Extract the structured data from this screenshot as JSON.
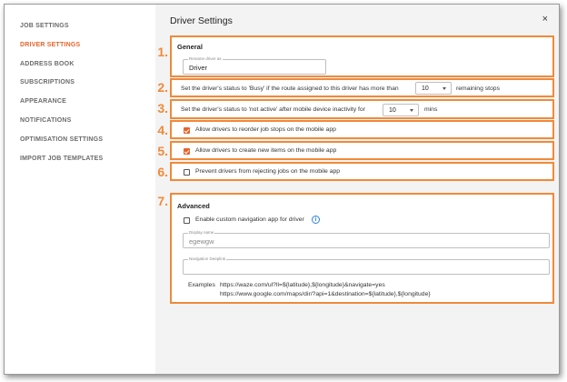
{
  "sidebar": {
    "items": [
      {
        "label": "JOB SETTINGS",
        "active": false
      },
      {
        "label": "DRIVER SETTINGS",
        "active": true
      },
      {
        "label": "ADDRESS BOOK",
        "active": false
      },
      {
        "label": "SUBSCRIPTIONS",
        "active": false
      },
      {
        "label": "APPEARANCE",
        "active": false
      },
      {
        "label": "NOTIFICATIONS",
        "active": false
      },
      {
        "label": "OPTIMISATION SETTINGS",
        "active": false
      },
      {
        "label": "IMPORT JOB TEMPLATES",
        "active": false
      }
    ]
  },
  "header": {
    "title": "Driver Settings",
    "close_label": "×"
  },
  "annotations": [
    "1.",
    "2.",
    "3.",
    "4.",
    "5.",
    "6.",
    "7."
  ],
  "general": {
    "section_title": "General",
    "rename_label": "Rename driver as",
    "rename_value": "Driver"
  },
  "busy": {
    "text_before": "Set the driver's status to 'Busy' if the route assigned to this driver has more than",
    "value": "10",
    "text_after": "remaining stops"
  },
  "inactive": {
    "text_before": "Set the driver's status to 'not active' after mobile device inactivity for",
    "value": "10",
    "text_after": "mins"
  },
  "reorder": {
    "label": "Allow drivers to reorder job stops on the mobile app",
    "checked": true
  },
  "create_items": {
    "label": "Allow drivers to create new items on the mobile app",
    "checked": true
  },
  "prevent_reject": {
    "label": "Prevent drivers from rejecting jobs on the mobile app",
    "checked": false
  },
  "advanced": {
    "section_title": "Advanced",
    "custom_nav_label": "Enable custom navigation app for driver",
    "custom_nav_checked": false,
    "info_icon": "i",
    "display_name_label": "Display name",
    "display_name_value": "egewgw",
    "deeplink_label": "Navigation Deeplink",
    "deeplink_value": "",
    "examples_label": "Examples",
    "example_1": "https://waze.com/ul?ll=${latitude},${longitude}&navigate=yes",
    "example_2": "https://www.google.com/maps/dir/?api=1&destination=${latitude},${longitude}"
  },
  "colors": {
    "accent": "#e8632a",
    "annotation": "#f08a3a",
    "info": "#2a82e4"
  }
}
